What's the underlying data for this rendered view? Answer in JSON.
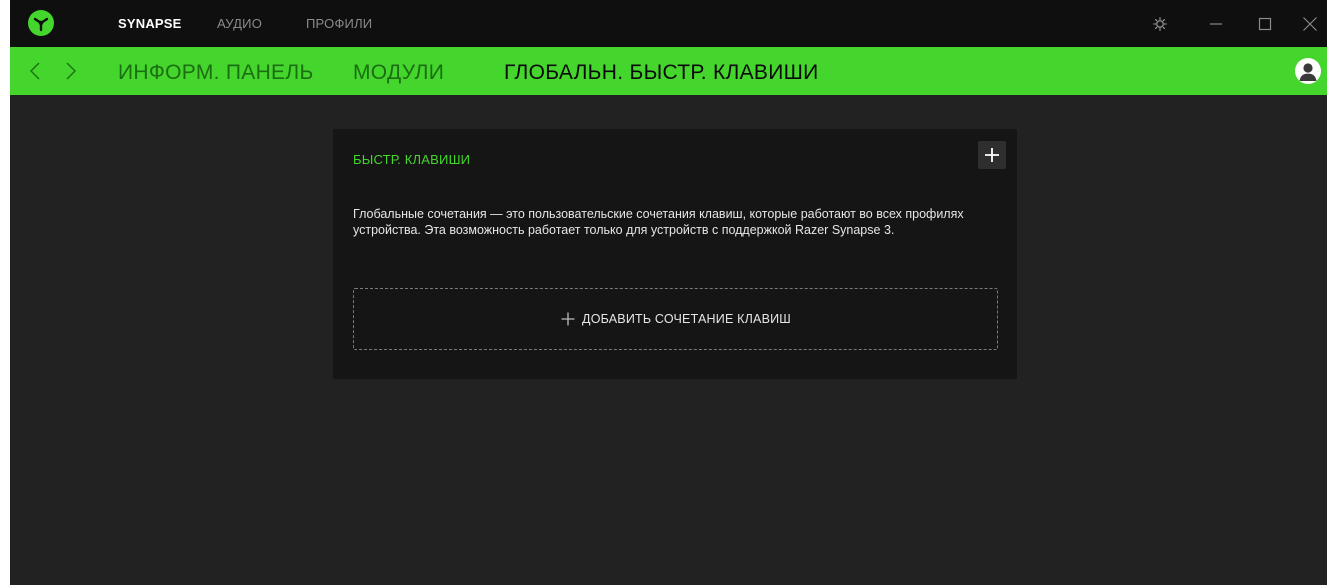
{
  "app": {
    "top_tabs": [
      {
        "label": "SYNAPSE",
        "active": true
      },
      {
        "label": "АУДИО",
        "active": false
      },
      {
        "label": "ПРОФИЛИ",
        "active": false
      }
    ],
    "window_controls": {
      "settings_icon": "gear-icon",
      "minimize_icon": "minimize-icon",
      "maximize_icon": "maximize-icon",
      "close_icon": "close-icon"
    }
  },
  "nav": {
    "back_icon": "chevron-left-icon",
    "forward_icon": "chevron-right-icon",
    "tabs": [
      {
        "label": "ИНФОРМ. ПАНЕЛЬ",
        "active": false
      },
      {
        "label": "МОДУЛИ",
        "active": false
      },
      {
        "label": "ГЛОБАЛЬН. БЫСТР. КЛАВИШИ",
        "active": true
      }
    ],
    "avatar_icon": "user-avatar-icon"
  },
  "card": {
    "title": "БЫСТР. КЛАВИШИ",
    "description": "Глобальные сочетания — это пользовательские сочетания клавиш, которые работают во всех профилях устройства. Эта возможность работает только для устройств с поддержкой Razer Synapse 3.",
    "add_button_label": "ДОБАВИТЬ СОЧЕТАНИЕ КЛАВИШ"
  },
  "colors": {
    "accent": "#44d62c",
    "background": "#222222",
    "titlebar": "#0f0f0f",
    "card": "#151515"
  }
}
